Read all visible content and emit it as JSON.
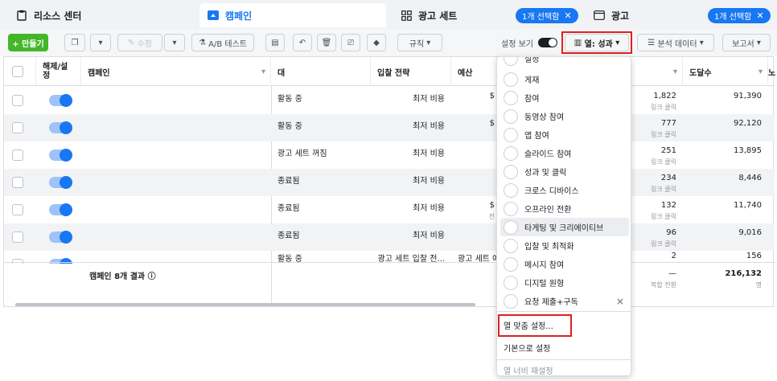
{
  "tabs": [
    {
      "label": "리소스 센터",
      "icon": "clipboard-icon"
    },
    {
      "label": "캠페인",
      "icon": "folder-icon"
    },
    {
      "label": "광고 세트",
      "icon": "grid-icon",
      "badge": "1개 선택함"
    },
    {
      "label": "광고",
      "icon": "ad-icon",
      "badge": "1개 선택함"
    }
  ],
  "toolbar": {
    "create": "+ 만들기",
    "edit": "수정",
    "ab_test": "A/B 테스트",
    "rules": "규칙",
    "view_setup": "설정 보기",
    "columns": "열: 성과",
    "breakdown": "분석 데이터",
    "reports": "보고서"
  },
  "table": {
    "headers": {
      "toggle": "해제/설정",
      "campaign": "캠페인",
      "delivery": "대",
      "bid": "입찰 전략",
      "budget": "예산",
      "reach": "도달수"
    },
    "rows": [
      {
        "delivery": "활동 중",
        "bid": "최저 비용",
        "budget": "$",
        "result": "1,822",
        "result_sub": "링크 클릭",
        "reach": "91,390"
      },
      {
        "delivery": "활동 중",
        "bid": "최저 비용",
        "budget": "$",
        "result": "777",
        "result_sub": "링크 클릭",
        "reach": "92,120"
      },
      {
        "delivery": "광고 세트 꺼짐",
        "bid": "최저 비용",
        "budget": "",
        "result": "251",
        "result_sub": "링크 클릭",
        "reach": "13,895"
      },
      {
        "delivery": "종료됨",
        "bid": "최저 비용",
        "budget": "",
        "result": "234",
        "result_sub": "링크 클릭",
        "reach": "8,446"
      },
      {
        "delivery": "종료됨",
        "bid": "최저 비용",
        "budget": "$",
        "budget_sub": "전",
        "result": "132",
        "result_sub": "링크 클릭",
        "reach": "11,740"
      },
      {
        "delivery": "종료됨",
        "bid": "최저 비용",
        "budget": "",
        "result": "96",
        "result_sub": "링크 클릭",
        "reach": "9,016"
      },
      {
        "delivery": "활동 중",
        "bid": "광고 세트 입찰 전...",
        "budget": "광고 세트 예...",
        "result": "2",
        "result_sub": "",
        "reach": "156"
      }
    ],
    "footer": {
      "summary": "캠페인 8개 결과",
      "result": "—",
      "result_sub": "복합 전환",
      "reach": "216,132",
      "reach_sub": "명"
    }
  },
  "menu": {
    "items": [
      "게재",
      "참여",
      "동영상 참여",
      "앱 참여",
      "슬라이드 참여",
      "성과 및 클릭",
      "크로스 디바이스",
      "오프라인 전환",
      "타게팅 및 크리에이티브",
      "입찰 및 최적화",
      "메시지 참여",
      "디지털 원형",
      "요청 제출+구독"
    ],
    "partial_top": "실정",
    "custom": "열 맞춤 설정...",
    "default": "기본으로 설정",
    "reset_width": "열 너비 재설정",
    "close": "×"
  },
  "colors": {
    "accent": "#1877f2",
    "create": "#42b72a",
    "highlight": "#e02020"
  }
}
